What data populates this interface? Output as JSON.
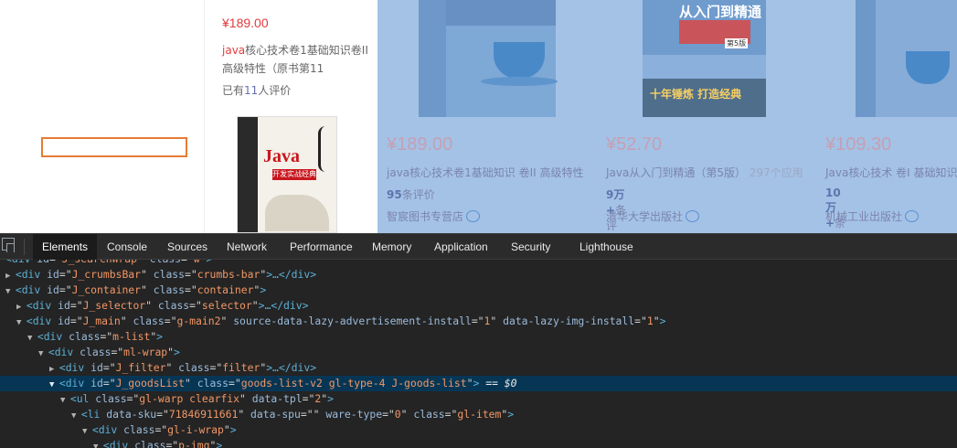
{
  "page": {
    "left_item": {
      "price": "¥189.00",
      "title_highlight": "java",
      "title_rest": "核心技术卷1基础知识卷II 高级特性（原书第11",
      "comment_prefix": "已有",
      "comment_count": "11",
      "comment_suffix": "人评价",
      "book_title": "Java",
      "book_bar": "开发实战经典"
    },
    "products": [
      {
        "price": "¥189.00",
        "title": "java核心技术卷1基础知识 卷II 高级特性",
        "title_sub": "",
        "comment_count": "95",
        "comment_suffix": "条评价",
        "shop": "智宸图书专营店",
        "cover_icon": "coffee-cup-icon"
      },
      {
        "price": "¥52.70",
        "title": "Java从入门到精通（第5版）",
        "title_sub": "297个应用",
        "comment_count": "9万+",
        "comment_suffix": "条评价",
        "shop": "清华大学出版社",
        "cover_title": "从入门到精通",
        "cover_edition": "第5版",
        "cover_slogan": "十年锤炼  打造经典"
      },
      {
        "price": "¥109.30",
        "title": "Java核心技术 卷I 基础知识",
        "title_sub": "",
        "comment_count": "10万+",
        "comment_suffix": "条评价",
        "shop": "机械工业出版社",
        "cover_icon": "coffee-cup-icon"
      }
    ],
    "overlay_color": "#a4c2e6"
  },
  "devtools": {
    "tabs": [
      "Elements",
      "Console",
      "Sources",
      "Network",
      "Performance",
      "Memory",
      "Application",
      "Security",
      "Lighthouse"
    ],
    "active_tab": "Elements",
    "dom_lines": [
      {
        "indent": 0,
        "arrow": "",
        "tag_open": "<div",
        "attrs": [
          [
            "id",
            "J_searchWrap"
          ],
          [
            "class",
            "w"
          ]
        ],
        "tail": ">",
        "clipped": true
      },
      {
        "indent": 0,
        "arrow": "▶",
        "tag_open": "<div",
        "attrs": [
          [
            "id",
            "J_crumbsBar"
          ],
          [
            "class",
            "crumbs-bar"
          ]
        ],
        "tail": ">…</div>"
      },
      {
        "indent": 0,
        "arrow": "▼",
        "tag_open": "<div",
        "attrs": [
          [
            "id",
            "J_container"
          ],
          [
            "class",
            "container"
          ]
        ],
        "tail": ">"
      },
      {
        "indent": 1,
        "arrow": "▶",
        "tag_open": "<div",
        "attrs": [
          [
            "id",
            "J_selector"
          ],
          [
            "class",
            "selector"
          ]
        ],
        "tail": ">…</div>"
      },
      {
        "indent": 1,
        "arrow": "▼",
        "tag_open": "<div",
        "attrs": [
          [
            "id",
            "J_main"
          ],
          [
            "class",
            "g-main2"
          ],
          [
            "source-data-lazy-advertisement-install",
            "1"
          ],
          [
            "data-lazy-img-install",
            "1"
          ]
        ],
        "tail": ">"
      },
      {
        "indent": 2,
        "arrow": "▼",
        "tag_open": "<div",
        "attrs": [
          [
            "class",
            "m-list"
          ]
        ],
        "tail": ">"
      },
      {
        "indent": 3,
        "arrow": "▼",
        "tag_open": "<div",
        "attrs": [
          [
            "class",
            "ml-wrap"
          ]
        ],
        "tail": ">"
      },
      {
        "indent": 4,
        "arrow": "▶",
        "tag_open": "<div",
        "attrs": [
          [
            "id",
            "J_filter"
          ],
          [
            "class",
            "filter"
          ]
        ],
        "tail": ">…</div>"
      },
      {
        "indent": 4,
        "arrow": "▼",
        "tag_open": "<div",
        "attrs": [
          [
            "id",
            "J_goodsList"
          ],
          [
            "class",
            "goods-list-v2 gl-type-4 J-goods-list"
          ]
        ],
        "tail": ">",
        "selected": true,
        "marker": "== $0"
      },
      {
        "indent": 5,
        "arrow": "▼",
        "tag_open": "<ul",
        "attrs": [
          [
            "class",
            "gl-warp clearfix"
          ],
          [
            "data-tpl",
            "2"
          ]
        ],
        "tail": ">"
      },
      {
        "indent": 6,
        "arrow": "▼",
        "tag_open": "<li",
        "attrs": [
          [
            "data-sku",
            "71846911661"
          ],
          [
            "data-spu",
            ""
          ],
          [
            "ware-type",
            "0"
          ],
          [
            "class",
            "gl-item"
          ]
        ],
        "tail": ">"
      },
      {
        "indent": 7,
        "arrow": "▼",
        "tag_open": "<div",
        "attrs": [
          [
            "class",
            "gl-i-wrap"
          ]
        ],
        "tail": ">"
      },
      {
        "indent": 8,
        "arrow": "▼",
        "tag_open": "<div",
        "attrs": [
          [
            "class",
            "p-img"
          ]
        ],
        "tail": ">"
      }
    ]
  }
}
